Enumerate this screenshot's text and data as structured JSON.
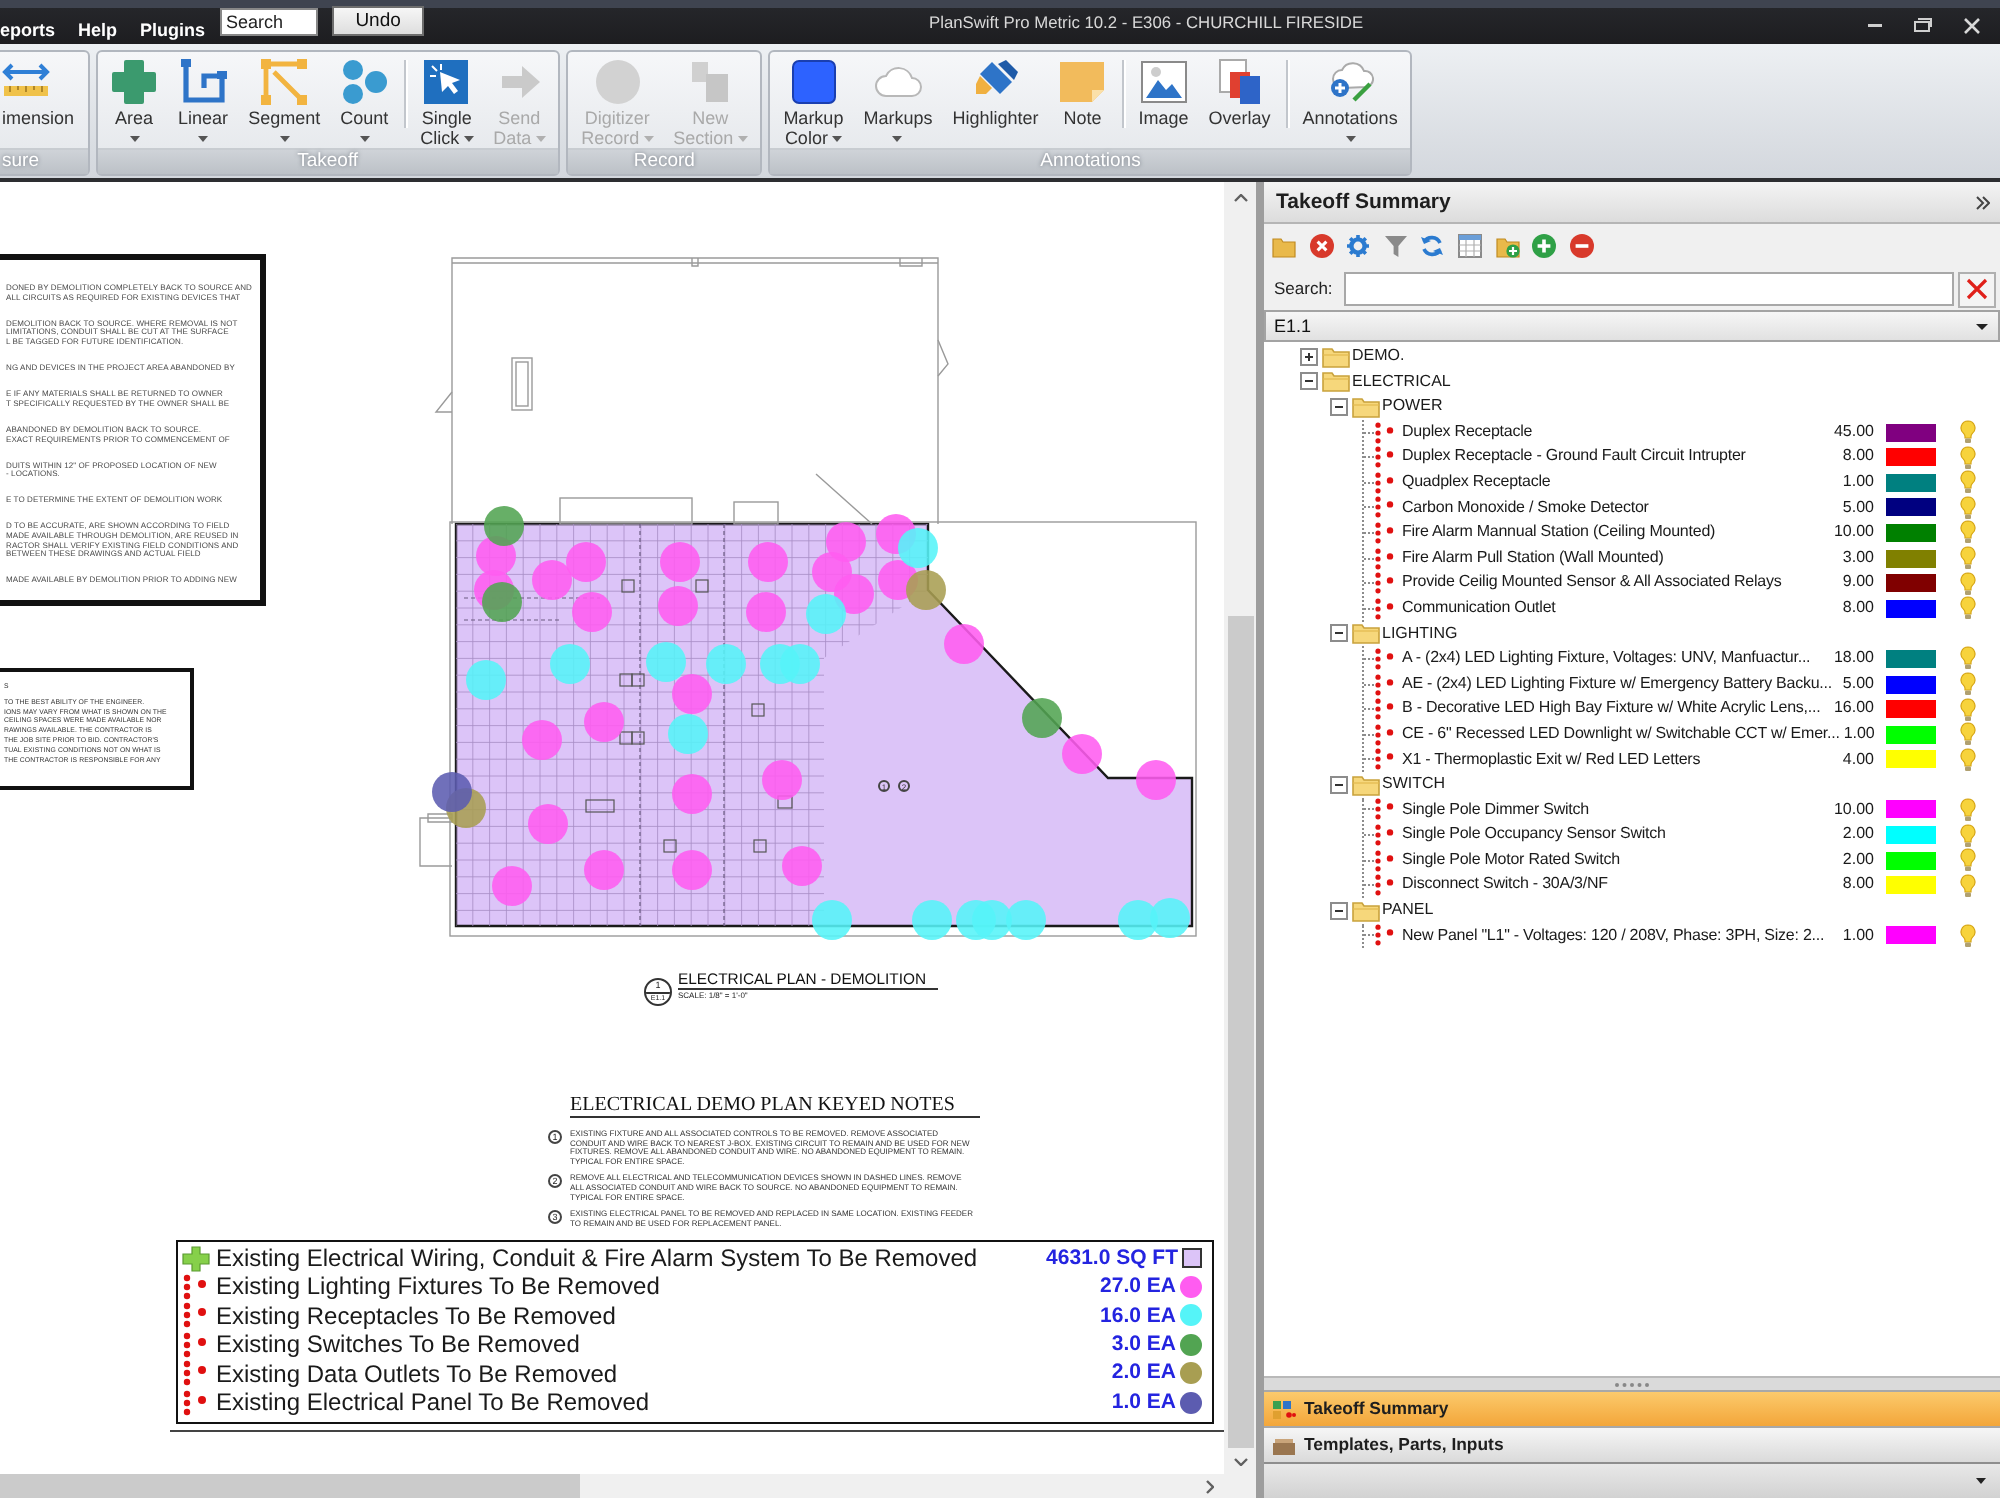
{
  "title_bar": {
    "menus": [
      "eports",
      "Help",
      "Plugins"
    ],
    "search": {
      "placeholder": "Search"
    },
    "undo_button": "Undo",
    "title": "PlanSwift Pro Metric 10.2 - E306 - CHURCHILL FIRESIDE"
  },
  "ribbon": {
    "groups": [
      {
        "label": "sure",
        "sections": [
          [
            {
              "kind": "dimension",
              "label": "imension",
              "menu": false,
              "disabled": false
            }
          ]
        ]
      },
      {
        "label": "Takeoff",
        "sections": [
          [
            {
              "kind": "area",
              "label": "Area",
              "menu": true,
              "disabled": false
            },
            {
              "kind": "linear",
              "label": "Linear",
              "menu": true,
              "disabled": false
            },
            {
              "kind": "segment",
              "label": "Segment",
              "menu": true,
              "disabled": false
            },
            {
              "kind": "count",
              "label": "Count",
              "menu": true,
              "disabled": false
            }
          ],
          [
            {
              "kind": "pointer",
              "label": "Single Click",
              "menu": true,
              "disabled": false
            },
            {
              "kind": "send",
              "label": "Send Data",
              "menu": true,
              "disabled": true
            }
          ]
        ]
      },
      {
        "label": "Record",
        "sections": [
          [
            {
              "kind": "digitizer",
              "label": "Digitizer Record",
              "menu": true,
              "disabled": true
            },
            {
              "kind": "section",
              "label": "New Section",
              "menu": true,
              "disabled": true
            }
          ]
        ]
      },
      {
        "label": "Annotations",
        "sections": [
          [
            {
              "kind": "swatch",
              "label": "Markup Color",
              "menu": true,
              "disabled": false
            },
            {
              "kind": "cloud",
              "label": "Markups",
              "menu": true,
              "disabled": false
            },
            {
              "kind": "highlighter",
              "label": "Highlighter",
              "menu": false,
              "disabled": false
            },
            {
              "kind": "note",
              "label": "Note",
              "menu": false,
              "disabled": false
            }
          ],
          [
            {
              "kind": "image",
              "label": "Image",
              "menu": false,
              "disabled": false
            },
            {
              "kind": "overlay",
              "label": "Overlay",
              "menu": false,
              "disabled": false
            }
          ],
          [
            {
              "kind": "annotation",
              "label": "Annotations",
              "menu": true,
              "disabled": false
            }
          ]
        ]
      }
    ]
  },
  "drawing": {
    "general_notes": [
      [
        "DONED BY DEMOLITION COMPLETELY BACK TO SOURCE AND",
        "ALL CIRCUITS AS REQUIRED FOR EXISTING DEVICES THAT"
      ],
      [
        "DEMOLITION BACK TO SOURCE. WHERE REMOVAL IS NOT",
        "LIMITATIONS, CONDUIT SHALL BE CUT AT THE SURFACE",
        "L BE TAGGED FOR FUTURE IDENTIFICATION."
      ],
      [
        "NG AND DEVICES IN THE PROJECT AREA ABANDONED BY"
      ],
      [
        "E IF ANY MATERIALS SHALL BE RETURNED TO OWNER",
        "T SPECIFICALLY REQUESTED BY THE OWNER SHALL BE"
      ],
      [
        "ABANDONED BY DEMOLITION BACK TO SOURCE.",
        "EXACT REQUIREMENTS PRIOR TO COMMENCEMENT OF"
      ],
      [
        "DUITS WITHIN 12\" OF PROPOSED LOCATION OF NEW",
        "- LOCATIONS."
      ],
      [
        "E TO DETERMINE THE EXTENT OF DEMOLITION WORK"
      ],
      [
        "D TO BE ACCURATE, ARE SHOWN ACCORDING TO FIELD",
        "MADE AVAILABLE THROUGH DEMOLITION, ARE REUSED IN",
        "RACTOR SHALL VERIFY EXISTING FIELD CONDITIONS AND",
        "BETWEEN THESE DRAWINGS AND ACTUAL FIELD"
      ],
      [
        "MADE AVAILABLE BY DEMOLITION PRIOR TO ADDING NEW"
      ]
    ],
    "disclaimer": [
      [
        "S"
      ],
      [
        "TO THE BEST ABILITY OF THE ENGINEER.",
        "IONS MAY VARY FROM WHAT IS SHOWN ON THE",
        "CEILING SPACES WERE MADE AVAILABLE NOR",
        "RAWINGS AVAILABLE. THE CONTRACTOR IS",
        "THE JOB SITE PRIOR TO BID. CONTRACTOR'S",
        "TUAL EXISTING CONDITIONS NOT ON WHAT IS",
        "THE CONTRACTOR IS RESPONSIBLE FOR ANY"
      ]
    ],
    "plan_tags": [
      "1",
      "2"
    ],
    "plan_title": {
      "detail": "1",
      "sheet": "E1.1",
      "title": "ELECTRICAL PLAN - DEMOLITION",
      "scale": "SCALE: 1/8\" = 1'-0\""
    },
    "keyed_notes": {
      "title": "ELECTRICAL DEMO PLAN KEYED NOTES",
      "notes": [
        {
          "number": "1",
          "text": "EXISTING FIXTURE AND ALL ASSOCIATED CONTROLS TO BE REMOVED. REMOVE ASSOCIATED CONDUIT AND WIRE BACK TO NEAREST J-BOX. EXISTING CIRCUIT TO REMAIN AND BE USED FOR NEW FIXTURES. REMOVE ALL ABANDONED CONDUIT AND WIRE. NO ABANDONED EQUIPMENT TO REMAIN. TYPICAL FOR ENTIRE SPACE."
        },
        {
          "number": "2",
          "text": "REMOVE ALL ELECTRICAL AND TELECOMMUNICATION DEVICES SHOWN IN DASHED LINES. REMOVE ALL ASSOCIATED CONDUIT AND WIRE BACK TO SOURCE. NO ABANDONED EQUIPMENT TO REMAIN. TYPICAL FOR ENTIRE SPACE."
        },
        {
          "number": "3",
          "text": "EXISTING ELECTRICAL PANEL TO BE REMOVED AND REPLACED IN SAME LOCATION. EXISTING FEEDER TO REMAIN AND BE USED FOR REPLACEMENT PANEL."
        }
      ]
    },
    "legend": [
      {
        "kind": "area",
        "label": "Existing Electrical Wiring, Conduit & Fire Alarm System To Be Removed",
        "quantity": "4631.0 SQ FT",
        "color": "#dcc4f8"
      },
      {
        "kind": "count",
        "label": "Existing Lighting Fixtures To Be Removed",
        "quantity": "27.0 EA",
        "color": "#ff5cf0"
      },
      {
        "kind": "count",
        "label": "Existing Receptacles To Be Removed",
        "quantity": "16.0 EA",
        "color": "#55f4f8"
      },
      {
        "kind": "count",
        "label": "Existing Switches To Be Removed",
        "quantity": "3.0 EA",
        "color": "#52a452"
      },
      {
        "kind": "count",
        "label": "Existing Data Outlets To Be Removed",
        "quantity": "2.0 EA",
        "color": "#a89e52"
      },
      {
        "kind": "count",
        "label": "Existing Electrical Panel To Be Removed",
        "quantity": "1.0 EA",
        "color": "#5c5cb0"
      }
    ]
  },
  "panel": {
    "title": "Takeoff Summary",
    "search_label": "Search:",
    "sheet": "E1.1",
    "tree": [
      {
        "kind": "folder",
        "label": "DEMO.",
        "expanded": false
      },
      {
        "kind": "folder",
        "label": "ELECTRICAL",
        "expanded": true,
        "children": [
          {
            "kind": "folder",
            "label": "POWER",
            "expanded": true,
            "children": [
              {
                "kind": "item",
                "label": "Duplex Receptacle",
                "quantity": "45.00",
                "color": "#800080",
                "visible": true
              },
              {
                "kind": "item",
                "label": "Duplex Receptacle - Ground Fault Circuit Intrupter",
                "quantity": "8.00",
                "color": "#ff0000",
                "visible": true
              },
              {
                "kind": "item",
                "label": "Quadplex Receptacle",
                "quantity": "1.00",
                "color": "#008080",
                "visible": true
              },
              {
                "kind": "item",
                "label": "Carbon Monoxide / Smoke Detector",
                "quantity": "5.00",
                "color": "#000080",
                "visible": true
              },
              {
                "kind": "item",
                "label": "Fire Alarm Mannual Station (Ceiling Mounted)",
                "quantity": "10.00",
                "color": "#008000",
                "visible": true
              },
              {
                "kind": "item",
                "label": "Fire Alarm Pull Station (Wall Mounted)",
                "quantity": "3.00",
                "color": "#808000",
                "visible": true
              },
              {
                "kind": "item",
                "label": "Provide Ceilig Mounted Sensor & All Associated Relays",
                "quantity": "9.00",
                "color": "#800000",
                "visible": true
              },
              {
                "kind": "item",
                "label": "Communication Outlet",
                "quantity": "8.00",
                "color": "#0000ff",
                "visible": true
              }
            ]
          },
          {
            "kind": "folder",
            "label": "LIGHTING",
            "expanded": true,
            "children": [
              {
                "kind": "item",
                "label": "A - (2x4) LED Lighting Fixture, Voltages: UNV, Manfuactur...",
                "quantity": "18.00",
                "color": "#008080",
                "visible": true
              },
              {
                "kind": "item",
                "label": "AE - (2x4) LED Lighting Fixture w/ Emergency Battery Backu...",
                "quantity": "5.00",
                "color": "#0000ff",
                "visible": true
              },
              {
                "kind": "item",
                "label": "B - Decorative LED High Bay Fixture w/ White Acrylic Lens,...",
                "quantity": "16.00",
                "color": "#ff0000",
                "visible": true
              },
              {
                "kind": "item",
                "label": "CE - 6\" Recessed LED Downlight w/ Switchable CCT w/ Emer...",
                "quantity": "1.00",
                "color": "#00ff00",
                "visible": true
              },
              {
                "kind": "item",
                "label": "X1 - Thermoplastic Exit w/ Red LED Letters",
                "quantity": "4.00",
                "color": "#ffff00",
                "visible": true
              }
            ]
          },
          {
            "kind": "folder",
            "label": "SWITCH",
            "expanded": true,
            "children": [
              {
                "kind": "item",
                "label": "Single Pole Dimmer Switch",
                "quantity": "10.00",
                "color": "#ff00ff",
                "visible": true
              },
              {
                "kind": "item",
                "label": "Single Pole Occupancy Sensor Switch",
                "quantity": "2.00",
                "color": "#00ffff",
                "visible": true
              },
              {
                "kind": "item",
                "label": "Single Pole Motor Rated Switch",
                "quantity": "2.00",
                "color": "#00ff00",
                "visible": true
              },
              {
                "kind": "item",
                "label": "Disconnect Switch - 30A/3/NF",
                "quantity": "8.00",
                "color": "#ffff00",
                "visible": true
              }
            ]
          },
          {
            "kind": "folder",
            "label": "PANEL",
            "expanded": true,
            "children": [
              {
                "kind": "item",
                "label": "New Panel \"L1\" - Voltages: 120 / 208V, Phase: 3PH, Size: 2...",
                "quantity": "1.00",
                "color": "#ff00ff",
                "visible": true
              }
            ]
          }
        ]
      }
    ],
    "tabs": [
      {
        "label": "Takeoff Summary",
        "selected": true
      },
      {
        "label": "Templates, Parts, Inputs",
        "selected": false
      }
    ]
  }
}
